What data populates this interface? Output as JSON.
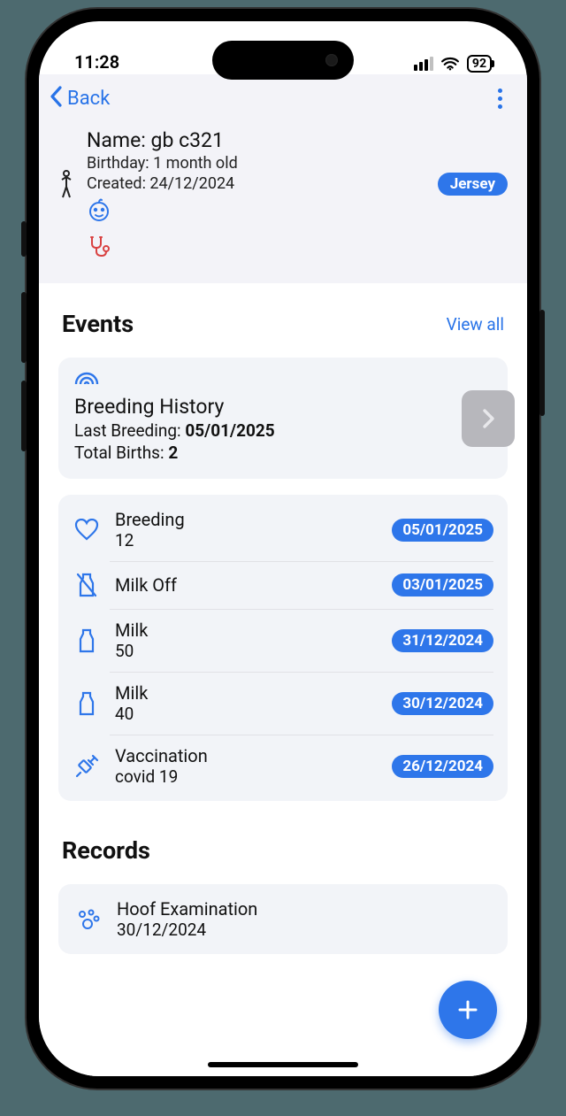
{
  "status": {
    "time": "11:28",
    "battery": "92"
  },
  "nav": {
    "back_label": "Back"
  },
  "profile": {
    "name_label": "Name: gb c321",
    "birthday_label": "Birthday: 1 month old",
    "created_label": "Created: 24/12/2024",
    "breed_badge": "Jersey"
  },
  "events": {
    "title": "Events",
    "view_all": "View all",
    "breeding_card": {
      "title": "Breeding History",
      "last_label": "Last Breeding: ",
      "last_value": "05/01/2025",
      "total_label": "Total Births: ",
      "total_value": "2"
    },
    "list": [
      {
        "title": "Breeding",
        "sub": "12",
        "date": "05/01/2025",
        "icon": "heart"
      },
      {
        "title": "Milk Off",
        "sub": "",
        "date": "03/01/2025",
        "icon": "milk-off"
      },
      {
        "title": "Milk",
        "sub": "50",
        "date": "31/12/2024",
        "icon": "milk"
      },
      {
        "title": "Milk",
        "sub": "40",
        "date": "30/12/2024",
        "icon": "milk"
      },
      {
        "title": "Vaccination",
        "sub": "covid 19",
        "date": "26/12/2024",
        "icon": "syringe"
      }
    ]
  },
  "records": {
    "title": "Records",
    "items": [
      {
        "title": "Hoof Examination",
        "date": "30/12/2024"
      }
    ]
  }
}
